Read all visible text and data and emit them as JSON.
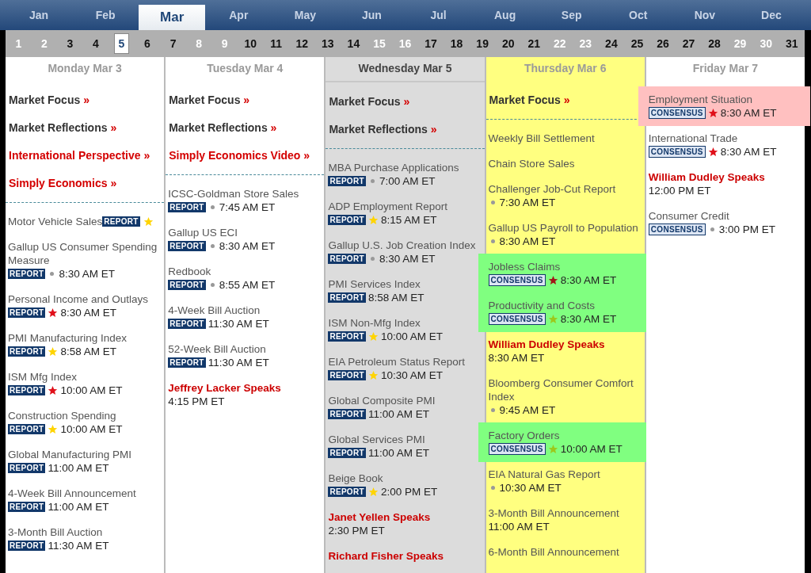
{
  "months": [
    {
      "label": "Jan",
      "selected": false
    },
    {
      "label": "Feb",
      "selected": false
    },
    {
      "label": "Mar",
      "selected": true
    },
    {
      "label": "Apr",
      "selected": false
    },
    {
      "label": "May",
      "selected": false
    },
    {
      "label": "Jun",
      "selected": false
    },
    {
      "label": "Jul",
      "selected": false
    },
    {
      "label": "Aug",
      "selected": false
    },
    {
      "label": "Sep",
      "selected": false
    },
    {
      "label": "Oct",
      "selected": false
    },
    {
      "label": "Nov",
      "selected": false
    },
    {
      "label": "Dec",
      "selected": false
    }
  ],
  "days": [
    {
      "label": "1",
      "disabled": true,
      "selected": false
    },
    {
      "label": "2",
      "disabled": true,
      "selected": false
    },
    {
      "label": "3",
      "disabled": false,
      "selected": false
    },
    {
      "label": "4",
      "disabled": false,
      "selected": false
    },
    {
      "label": "5",
      "disabled": false,
      "selected": true
    },
    {
      "label": "6",
      "disabled": false,
      "selected": false
    },
    {
      "label": "7",
      "disabled": false,
      "selected": false
    },
    {
      "label": "8",
      "disabled": true,
      "selected": false
    },
    {
      "label": "9",
      "disabled": true,
      "selected": false
    },
    {
      "label": "10",
      "disabled": false,
      "selected": false
    },
    {
      "label": "11",
      "disabled": false,
      "selected": false
    },
    {
      "label": "12",
      "disabled": false,
      "selected": false
    },
    {
      "label": "13",
      "disabled": false,
      "selected": false
    },
    {
      "label": "14",
      "disabled": false,
      "selected": false
    },
    {
      "label": "15",
      "disabled": true,
      "selected": false
    },
    {
      "label": "16",
      "disabled": true,
      "selected": false
    },
    {
      "label": "17",
      "disabled": false,
      "selected": false
    },
    {
      "label": "18",
      "disabled": false,
      "selected": false
    },
    {
      "label": "19",
      "disabled": false,
      "selected": false
    },
    {
      "label": "20",
      "disabled": false,
      "selected": false
    },
    {
      "label": "21",
      "disabled": false,
      "selected": false
    },
    {
      "label": "22",
      "disabled": true,
      "selected": false
    },
    {
      "label": "23",
      "disabled": true,
      "selected": false
    },
    {
      "label": "24",
      "disabled": false,
      "selected": false
    },
    {
      "label": "25",
      "disabled": false,
      "selected": false
    },
    {
      "label": "26",
      "disabled": false,
      "selected": false
    },
    {
      "label": "27",
      "disabled": false,
      "selected": false
    },
    {
      "label": "28",
      "disabled": false,
      "selected": false
    },
    {
      "label": "29",
      "disabled": true,
      "selected": false
    },
    {
      "label": "30",
      "disabled": true,
      "selected": false
    },
    {
      "label": "31",
      "disabled": false,
      "selected": false
    }
  ],
  "columns": [
    {
      "title": "Monday Mar 3",
      "selected": false,
      "today": false,
      "links": [
        {
          "text": "Market Focus",
          "arrow": "»",
          "kind": "commentary"
        },
        {
          "text": "Market Reflections",
          "arrow": "»",
          "kind": "commentary"
        },
        {
          "text": "International Perspective",
          "arrow": "»",
          "kind": "feature"
        },
        {
          "text": "Simply Economics",
          "arrow": "»",
          "kind": "feature"
        }
      ],
      "events": [
        {
          "kind": "inline",
          "name": "Motor Vehicle Sales",
          "badge": "REPORT",
          "marker": {
            "kind": "star",
            "color": "#ffd400"
          }
        },
        {
          "kind": "event",
          "name": "Gallup US Consumer Spending Measure",
          "badge": "REPORT",
          "marker": {
            "kind": "dot"
          },
          "time": "8:30 AM ET"
        },
        {
          "kind": "event",
          "name": "Personal Income and Outlays",
          "badge": "REPORT",
          "marker": {
            "kind": "star",
            "color": "#e0101a"
          },
          "time": "8:30 AM ET"
        },
        {
          "kind": "event",
          "name": "PMI Manufacturing Index",
          "badge": "REPORT",
          "marker": {
            "kind": "star",
            "color": "#ffd400"
          },
          "time": "8:58 AM ET"
        },
        {
          "kind": "event",
          "name": "ISM Mfg Index",
          "badge": "REPORT",
          "marker": {
            "kind": "star",
            "color": "#e0101a"
          },
          "time": "10:00 AM ET"
        },
        {
          "kind": "event",
          "name": "Construction Spending",
          "badge": "REPORT",
          "marker": {
            "kind": "star",
            "color": "#ffd400"
          },
          "time": "10:00 AM ET"
        },
        {
          "kind": "event",
          "name": "Global Manufacturing PMI",
          "badge": "REPORT",
          "time": "11:00 AM ET"
        },
        {
          "kind": "event",
          "name": "4-Week Bill Announcement",
          "badge": "REPORT",
          "time": "11:00 AM ET"
        },
        {
          "kind": "event",
          "name": "3-Month Bill Auction",
          "badge": "REPORT",
          "time": "11:30 AM ET"
        }
      ]
    },
    {
      "title": "Tuesday Mar 4",
      "selected": false,
      "today": false,
      "links": [
        {
          "text": "Market Focus",
          "arrow": "»",
          "kind": "commentary"
        },
        {
          "text": "Market Reflections",
          "arrow": "»",
          "kind": "commentary"
        },
        {
          "text": "Simply Economics Video",
          "arrow": "»",
          "kind": "feature"
        }
      ],
      "events": [
        {
          "kind": "event",
          "name": "ICSC-Goldman Store Sales",
          "badge": "REPORT",
          "marker": {
            "kind": "dot"
          },
          "time": "7:45 AM ET"
        },
        {
          "kind": "event",
          "name": "Gallup US ECI",
          "badge": "REPORT",
          "marker": {
            "kind": "dot"
          },
          "time": "8:30 AM ET"
        },
        {
          "kind": "event",
          "name": "Redbook",
          "badge": "REPORT",
          "marker": {
            "kind": "dot"
          },
          "time": "8:55 AM ET"
        },
        {
          "kind": "event",
          "name": "4-Week Bill Auction",
          "badge": "REPORT",
          "time": "11:30 AM ET"
        },
        {
          "kind": "event",
          "name": "52-Week Bill Auction",
          "badge": "REPORT",
          "time": "11:30 AM ET"
        },
        {
          "kind": "speaker",
          "name": "Jeffrey Lacker Speaks",
          "time": "4:15 PM ET"
        }
      ]
    },
    {
      "title": "Wednesday Mar 5",
      "selected": true,
      "today": false,
      "links": [
        {
          "text": "Market Focus",
          "arrow": "»",
          "kind": "commentary"
        },
        {
          "text": "Market Reflections",
          "arrow": "»",
          "kind": "commentary"
        }
      ],
      "events": [
        {
          "kind": "event",
          "name": "MBA Purchase Applications",
          "badge": "REPORT",
          "marker": {
            "kind": "dot"
          },
          "time": "7:00 AM ET"
        },
        {
          "kind": "event",
          "name": "ADP Employment Report",
          "badge": "REPORT",
          "marker": {
            "kind": "star",
            "color": "#ffd400"
          },
          "time": "8:15 AM ET"
        },
        {
          "kind": "event",
          "name": "Gallup U.S. Job Creation Index",
          "badge": "REPORT",
          "marker": {
            "kind": "dot"
          },
          "time": "8:30 AM ET"
        },
        {
          "kind": "event",
          "name": "PMI Services Index",
          "badge": "REPORT",
          "time": "8:58 AM ET"
        },
        {
          "kind": "event",
          "name": "ISM Non-Mfg Index",
          "badge": "REPORT",
          "marker": {
            "kind": "star",
            "color": "#ffd400"
          },
          "time": "10:00 AM ET"
        },
        {
          "kind": "event",
          "name": "EIA Petroleum Status Report",
          "badge": "REPORT",
          "marker": {
            "kind": "star",
            "color": "#ffd400"
          },
          "time": "10:30 AM ET"
        },
        {
          "kind": "event",
          "name": "Global Composite PMI",
          "badge": "REPORT",
          "time": "11:00 AM ET"
        },
        {
          "kind": "event",
          "name": "Global Services PMI",
          "badge": "REPORT",
          "time": "11:00 AM ET"
        },
        {
          "kind": "event",
          "name": "Beige Book",
          "badge": "REPORT",
          "marker": {
            "kind": "star",
            "color": "#ffd400"
          },
          "time": "2:00 PM ET"
        },
        {
          "kind": "speaker",
          "name": "Janet Yellen Speaks",
          "time": "2:30 PM ET"
        },
        {
          "kind": "speaker",
          "name": "Richard Fisher Speaks"
        }
      ]
    },
    {
      "title": "Thursday Mar 6",
      "selected": false,
      "today": true,
      "links": [
        {
          "text": "Market Focus",
          "arrow": "»",
          "kind": "commentary"
        }
      ],
      "events": [
        {
          "kind": "event",
          "name": "Weekly Bill Settlement"
        },
        {
          "kind": "event",
          "name": "Chain Store Sales"
        },
        {
          "kind": "event",
          "name": "Challenger Job-Cut Report",
          "marker": {
            "kind": "dot"
          },
          "time": "7:30 AM ET"
        },
        {
          "kind": "event",
          "name": "Gallup US Payroll to Population",
          "marker": {
            "kind": "dot"
          },
          "time": "8:30 AM ET"
        },
        {
          "kind": "event",
          "name": "Jobless Claims",
          "badge": "CONSENSUS",
          "marker": {
            "kind": "star",
            "color": "#a01818"
          },
          "time": "8:30 AM ET",
          "color": "#80ff80"
        },
        {
          "kind": "event",
          "name": "Productivity and Costs",
          "badge": "CONSENSUS",
          "marker": {
            "kind": "star",
            "color": "#9cc81c"
          },
          "time": "8:30 AM ET",
          "color": "#80ff80"
        },
        {
          "kind": "speaker",
          "name": "William Dudley Speaks",
          "time": "8:30 AM ET"
        },
        {
          "kind": "event",
          "name": "Bloomberg Consumer Comfort Index",
          "marker": {
            "kind": "dot"
          },
          "time": "9:45 AM ET"
        },
        {
          "kind": "event",
          "name": "Factory Orders",
          "badge": "CONSENSUS",
          "marker": {
            "kind": "star",
            "color": "#9cc81c"
          },
          "time": "10:00 AM ET",
          "color": "#80ff80"
        },
        {
          "kind": "event",
          "name": "EIA Natural Gas Report",
          "marker": {
            "kind": "dot"
          },
          "time": "10:30 AM ET"
        },
        {
          "kind": "event",
          "name": "3-Month Bill Announcement",
          "time": "11:00 AM ET"
        },
        {
          "kind": "event",
          "name": "6-Month Bill Announcement"
        }
      ]
    },
    {
      "title": "Friday Mar 7",
      "selected": false,
      "today": false,
      "events": [
        {
          "kind": "event",
          "name": "Employment Situation",
          "badge": "CONSENSUS",
          "marker": {
            "kind": "star",
            "color": "#e0101a"
          },
          "time": "8:30 AM ET",
          "color": "#ffc0c0"
        },
        {
          "kind": "event",
          "name": "International Trade",
          "badge": "CONSENSUS",
          "marker": {
            "kind": "star",
            "color": "#e0101a"
          },
          "time": "8:30 AM ET"
        },
        {
          "kind": "speaker",
          "name": "William Dudley Speaks",
          "time": "12:00 PM ET"
        },
        {
          "kind": "event",
          "name": "Consumer Credit",
          "badge": "CONSENSUS",
          "marker": {
            "kind": "dot"
          },
          "time": "3:00 PM ET"
        }
      ]
    }
  ]
}
